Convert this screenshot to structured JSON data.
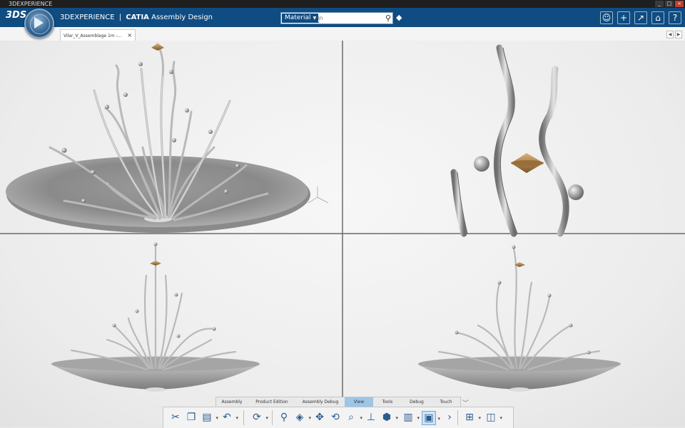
{
  "window": {
    "title": "3DEXPERIENCE"
  },
  "header": {
    "brand": "3DEXPERIENCE",
    "separator": "|",
    "product": "CATIA",
    "app": "Assembly Design",
    "logo": "3DS",
    "search": {
      "scope": "Material",
      "placeholder": "in",
      "search_icon": "search-icon"
    },
    "right_icons": [
      "user-icon",
      "plus-icon",
      "share-icon",
      "home-icon",
      "help-icon"
    ]
  },
  "document_tab": {
    "label": "Vilar_V_Assemblage 1m -...",
    "close": "×"
  },
  "action_bar": {
    "tabs": [
      "Assembly",
      "Product Edition",
      "Assembly Debug",
      "View",
      "Tools",
      "Debug",
      "Touch"
    ],
    "active_tab": "View",
    "tools": [
      "cut-icon",
      "copy-icon",
      "paste-icon",
      "undo-icon",
      "update-icon",
      "zoom-icon",
      "view-cube-icon",
      "pan-icon",
      "rotate-icon",
      "zoom-in-icon",
      "normal-view-icon",
      "render-style-icon",
      "hide-show-icon",
      "multi-view-icon",
      "next-icon",
      "tree-icon",
      "snapshot-icon"
    ]
  },
  "colors": {
    "appbar": "#0f4c81",
    "active_tab": "#9cc6e8",
    "model_metal": "#b8b8b8",
    "model_gold": "#a8804a"
  }
}
